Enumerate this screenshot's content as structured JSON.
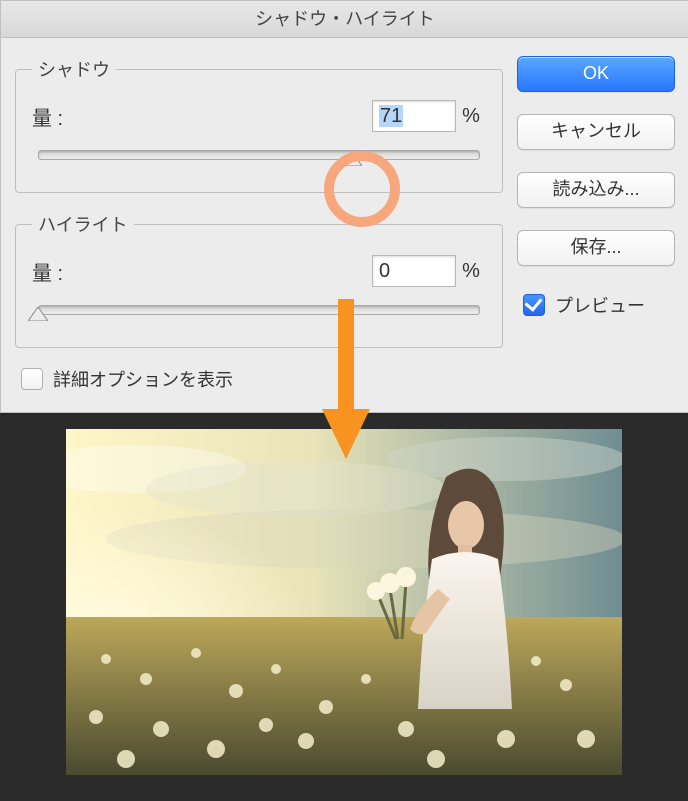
{
  "dialog": {
    "title": "シャドウ・ハイライト",
    "shadow": {
      "legend": "シャドウ",
      "amount_label": "量 :",
      "amount_value": "71",
      "amount_unit": "%",
      "slider_percent": 71
    },
    "highlight": {
      "legend": "ハイライト",
      "amount_label": "量 :",
      "amount_value": "0",
      "amount_unit": "%",
      "slider_percent": 0
    },
    "show_more_label": "詳細オプションを表示",
    "show_more_checked": false
  },
  "buttons": {
    "ok": "OK",
    "cancel": "キャンセル",
    "load": "読み込み...",
    "save": "保存..."
  },
  "preview": {
    "label": "プレビュー",
    "checked": true
  },
  "annotation": {
    "circle_color": "#f6a77d",
    "arrow_color": "#f7931e"
  }
}
